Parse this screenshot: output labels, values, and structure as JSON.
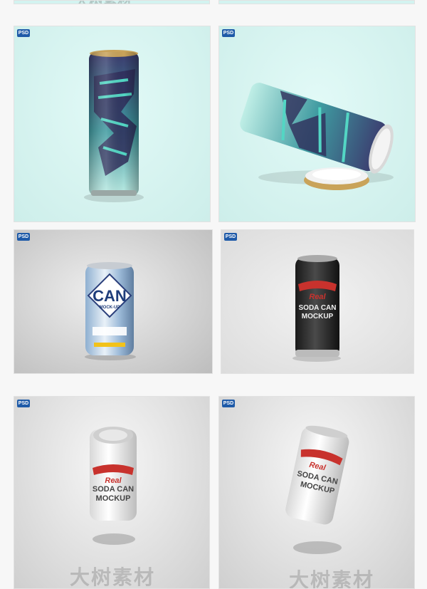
{
  "badge": "PSD",
  "watermark": "大树素材",
  "colors": {
    "mint_bg": "#d3f3f0",
    "grey_bg": "#dcdcdc",
    "badge": "#1e5aa8"
  },
  "cards": [
    {
      "title": "CAN",
      "subtitle": "MOCK-UP"
    },
    {
      "brand": "Real",
      "title": "SODA CAN",
      "subtitle": "MOCKUP"
    },
    {
      "brand": "Real",
      "title": "SODA CAN",
      "subtitle": "MOCKUP"
    },
    {
      "brand": "Real",
      "title": "SODA CAN",
      "subtitle": "MOCKUP"
    }
  ]
}
